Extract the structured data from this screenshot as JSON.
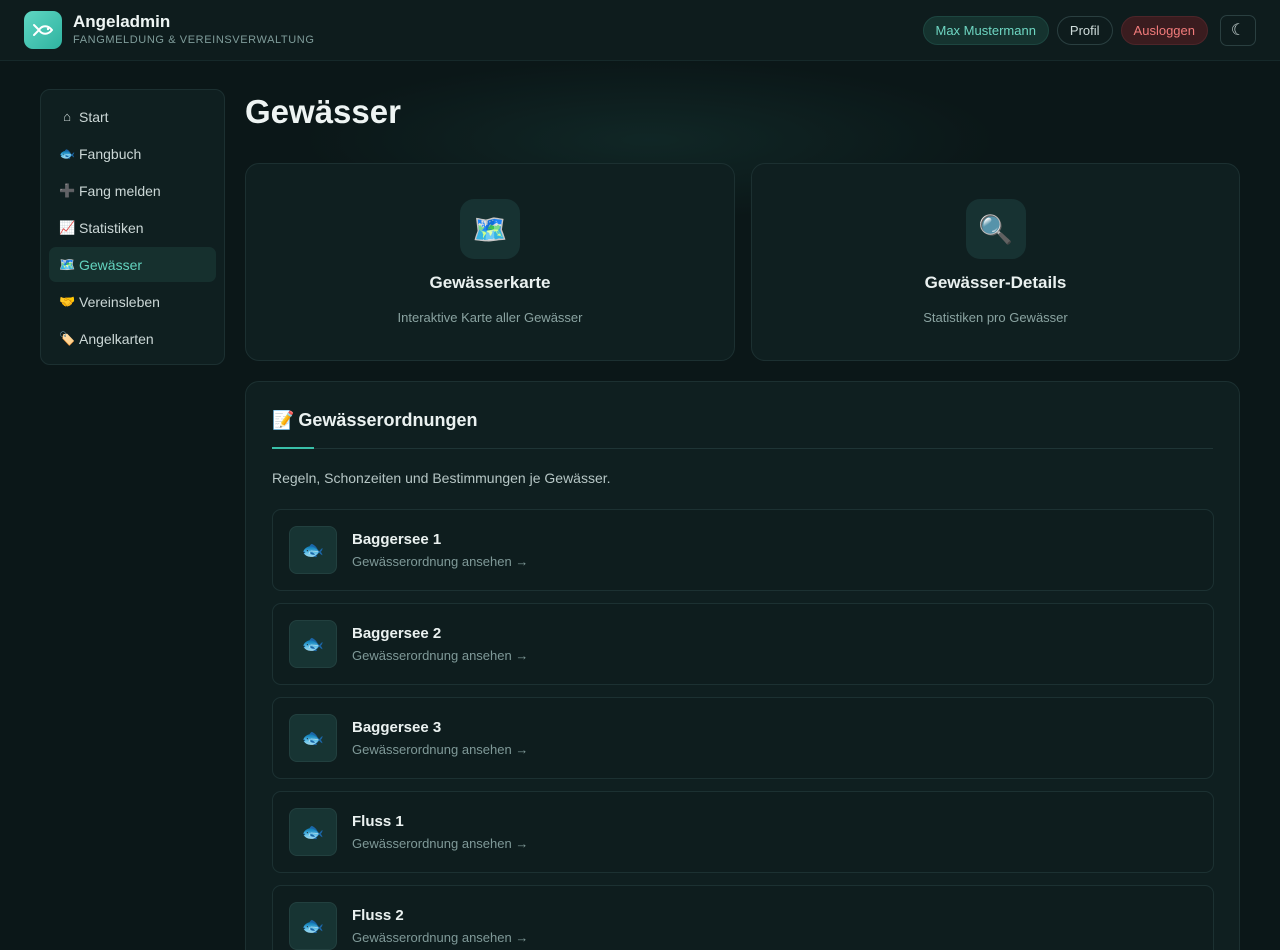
{
  "header": {
    "app_name": "Angeladmin",
    "app_subtitle": "FANGMELDUNG & VEREINSVERWALTUNG",
    "user_name": "Max Mustermann",
    "profile_label": "Profil",
    "logout_label": "Ausloggen",
    "theme_toggle_icon": "☾"
  },
  "sidebar": {
    "items": [
      {
        "icon": "⌂",
        "label": "Start"
      },
      {
        "icon": "🐟",
        "label": "Fangbuch"
      },
      {
        "icon": "➕",
        "label": "Fang melden"
      },
      {
        "icon": "📈",
        "label": "Statistiken"
      },
      {
        "icon": "🗺️",
        "label": "Gewässer"
      },
      {
        "icon": "🤝",
        "label": "Vereinsleben"
      },
      {
        "icon": "🏷️",
        "label": "Angelkarten"
      }
    ],
    "active": "Gewässer"
  },
  "main": {
    "title": "Gewässer",
    "cards": [
      {
        "icon": "🗺️",
        "title": "Gewässerkarte",
        "subtitle": "Interaktive Karte aller Gewässer"
      },
      {
        "icon": "🔍",
        "title": "Gewässer-Details",
        "subtitle": "Statistiken pro Gewässer"
      }
    ],
    "rules": {
      "icon": "📝",
      "title": "Gewässerordnungen",
      "description": "Regeln, Schonzeiten und Bestimmungen je Gewässer.",
      "link_label": "Gewässerordnung ansehen →",
      "waters": [
        {
          "name": "Baggersee 1"
        },
        {
          "name": "Baggersee 2"
        },
        {
          "name": "Baggersee 3"
        },
        {
          "name": "Fluss 1"
        },
        {
          "name": "Fluss 2"
        }
      ]
    }
  },
  "colors": {
    "accent": "#39bfa8",
    "background": "#0b1718",
    "logout": "#f27b7b"
  }
}
